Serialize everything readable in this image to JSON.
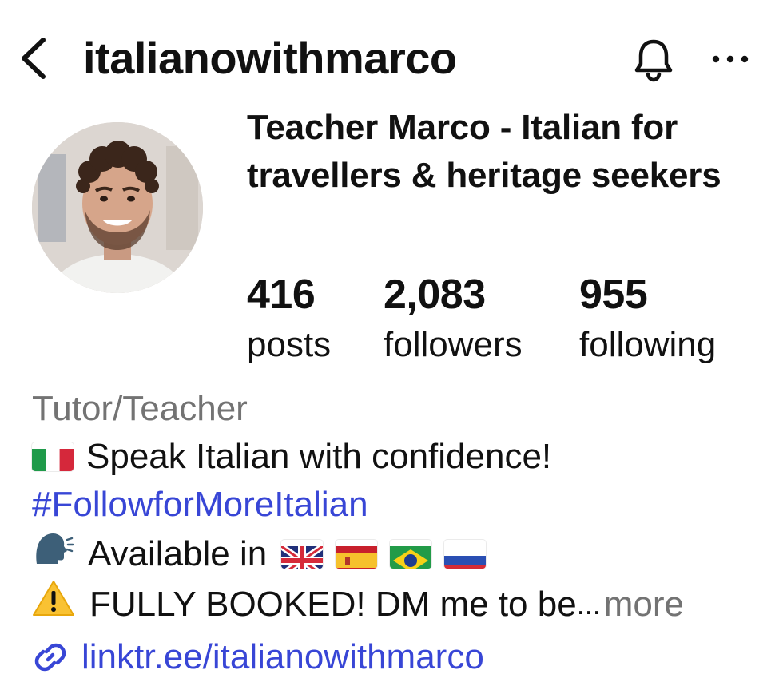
{
  "header": {
    "username": "italianowithmarco",
    "icons": [
      "back-chevron-icon",
      "bell-icon",
      "more-horizontal-icon"
    ]
  },
  "profile": {
    "display_name": "Teacher Marco - Italian for travellers & heritage seekers",
    "avatar": "profile-photo"
  },
  "stats": [
    {
      "value": "416",
      "label": "posts"
    },
    {
      "value": "2,083",
      "label": "followers"
    },
    {
      "value": "955",
      "label": "following"
    }
  ],
  "bio": {
    "category": "Tutor/Teacher",
    "line1_text": "Speak Italian with confidence!",
    "hashtag": "#FollowforMoreItalian",
    "line3_text": "Available in",
    "line4_text": "FULLY BOOKED! DM me to be",
    "ellipsis": "...",
    "more_label": "more",
    "emojis": [
      "italy-flag",
      "speaking-head",
      "uk-flag",
      "spain-flag",
      "brazil-flag",
      "russia-flag",
      "warning"
    ]
  },
  "link": {
    "text": "linktr.ee/italianowithmarco",
    "icon": "link-icon"
  },
  "colors": {
    "link_blue": "#3846d6",
    "secondary_gray": "#737373",
    "text": "#111111"
  }
}
